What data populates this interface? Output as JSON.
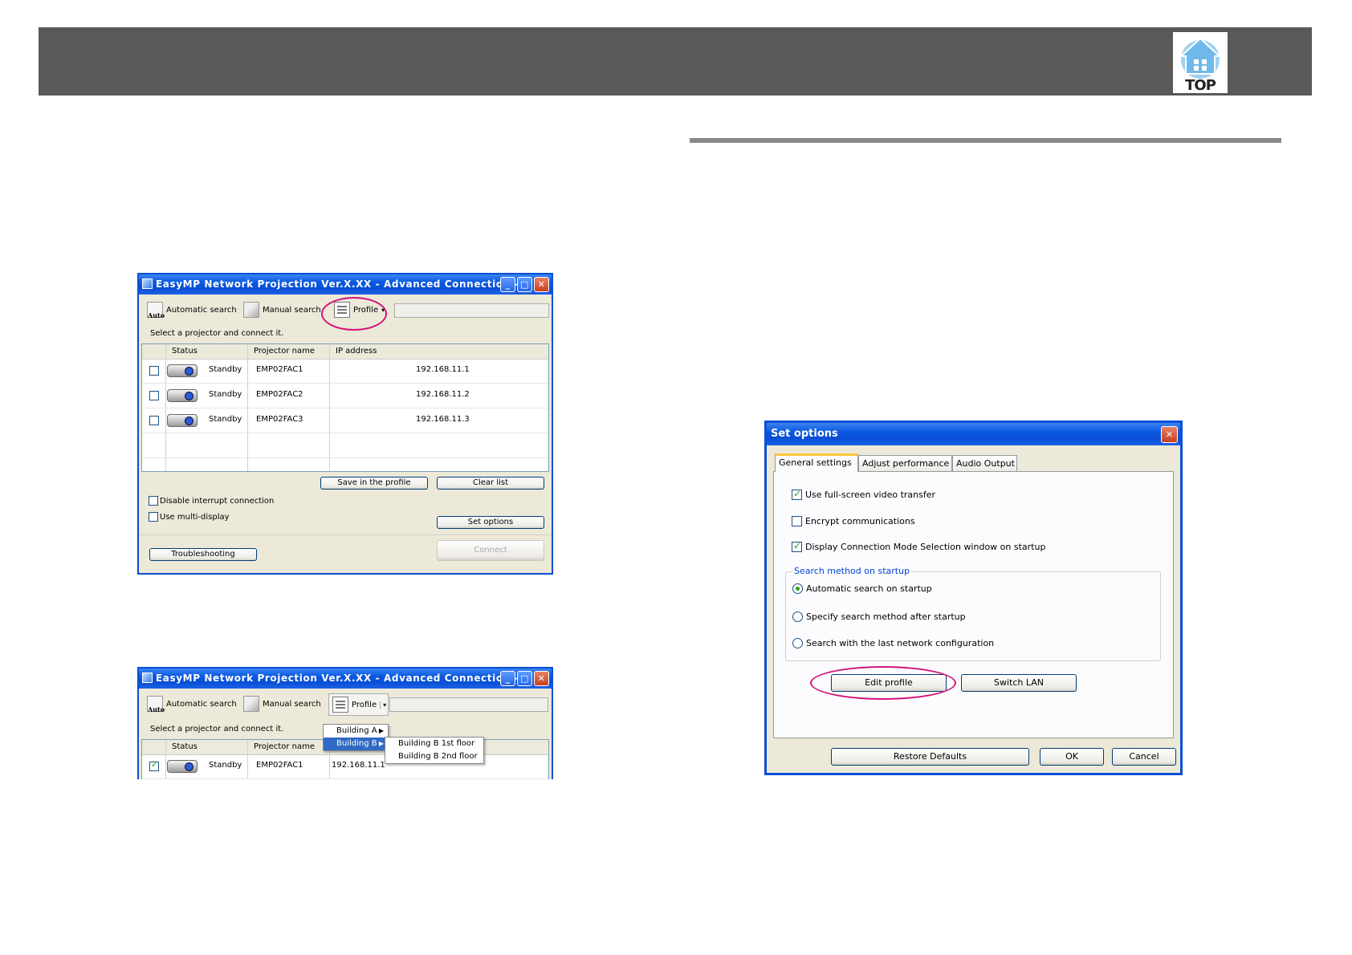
{
  "header": {
    "top_label": "TOP"
  },
  "window1": {
    "title": "EasyMP Network Projection Ver.X.XX - Advanced Connection -",
    "toolbar": {
      "auto_icon_text": "Auto",
      "automatic_search": "Automatic search",
      "manual_search": "Manual search",
      "profile": "Profile",
      "dropdown_arrow": "▾"
    },
    "hint": "Select a projector and connect it.",
    "columns": [
      "Status",
      "Projector name",
      "IP address"
    ],
    "rows": [
      {
        "status": "Standby",
        "name": "EMP02FAC1",
        "ip": "192.168.11.1",
        "checked": false
      },
      {
        "status": "Standby",
        "name": "EMP02FAC2",
        "ip": "192.168.11.2",
        "checked": false
      },
      {
        "status": "Standby",
        "name": "EMP02FAC3",
        "ip": "192.168.11.3",
        "checked": false
      }
    ],
    "save_in_profile": "Save in the profile",
    "clear_list": "Clear list",
    "disable_interrupt": "Disable interrupt connection",
    "use_multi_display": "Use multi-display",
    "set_options": "Set options",
    "troubleshooting": "Troubleshooting",
    "connect": "Connect"
  },
  "window2": {
    "title": "EasyMP Network Projection Ver.X.XX - Advanced Connection -",
    "toolbar": {
      "auto_icon_text": "Auto",
      "automatic_search": "Automatic search",
      "manual_search": "Manual search",
      "profile": "Profile",
      "dropdown_arrow": "▾"
    },
    "hint": "Select a projector and connect it.",
    "columns": [
      "Status",
      "Projector name"
    ],
    "menu": [
      "Building A",
      "Building B"
    ],
    "submenu": [
      "Building B 1st floor",
      "Building B 2nd floor"
    ],
    "row": {
      "status": "Standby",
      "name": "EMP02FAC1",
      "ip": "192.168.11.1",
      "checked": true
    }
  },
  "set_options": {
    "title": "Set options",
    "tabs": [
      "General settings",
      "Adjust performance",
      "Audio Output"
    ],
    "checkboxes": [
      {
        "label": "Use full-screen video transfer",
        "checked": true
      },
      {
        "label": "Encrypt communications",
        "checked": false
      },
      {
        "label": "Display Connection Mode Selection window on startup",
        "checked": true
      }
    ],
    "group_label": "Search method on startup",
    "radios": [
      {
        "label": "Automatic search on startup",
        "selected": true
      },
      {
        "label": "Specify search method after startup",
        "selected": false
      },
      {
        "label": "Search with the last network configuration",
        "selected": false
      }
    ],
    "edit_profile": "Edit profile",
    "switch_lan": "Switch LAN",
    "restore_defaults": "Restore Defaults",
    "ok": "OK",
    "cancel": "Cancel"
  },
  "colors": {
    "header_bar": "#595959",
    "xp_title": "#0a4fd6",
    "highlight_ellipse": "#d4147a",
    "group_label": "#0046d5"
  }
}
